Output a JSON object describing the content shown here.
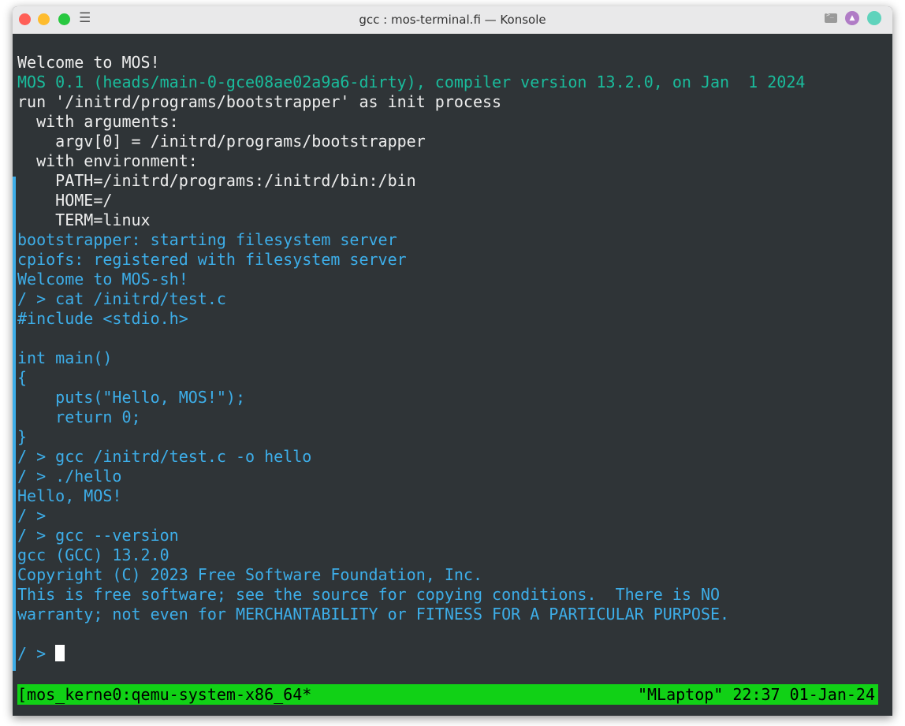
{
  "window": {
    "title": "gcc : mos-terminal.fi — Konsole",
    "menu_icon": "☰",
    "right_icons": [
      "terminal-icon",
      "arrow-up-icon",
      "keep-above-icon"
    ]
  },
  "terminal": {
    "lines": [
      {
        "text": "Welcome to MOS!",
        "color": "white"
      },
      {
        "text": "MOS 0.1 (heads/main-0-gce08ae02a9a6-dirty), compiler version 13.2.0, on Jan  1 2024",
        "color": "green"
      },
      {
        "text": "run '/initrd/programs/bootstrapper' as init process",
        "color": "white"
      },
      {
        "text": "  with arguments:",
        "color": "white"
      },
      {
        "text": "    argv[0] = /initrd/programs/bootstrapper",
        "color": "white"
      },
      {
        "text": "  with environment:",
        "color": "white"
      },
      {
        "text": "    PATH=/initrd/programs:/initrd/bin:/bin",
        "color": "white"
      },
      {
        "text": "    HOME=/",
        "color": "white"
      },
      {
        "text": "    TERM=linux",
        "color": "white"
      },
      {
        "text": "bootstrapper: starting filesystem server",
        "color": "blue"
      },
      {
        "text": "cpiofs: registered with filesystem server",
        "color": "blue"
      },
      {
        "text": "Welcome to MOS-sh!",
        "color": "blue"
      },
      {
        "text": "/ > cat /initrd/test.c",
        "color": "blue"
      },
      {
        "text": "#include <stdio.h>",
        "color": "blue"
      },
      {
        "text": "",
        "color": "blue"
      },
      {
        "text": "int main()",
        "color": "blue"
      },
      {
        "text": "{",
        "color": "blue"
      },
      {
        "text": "    puts(\"Hello, MOS!\");",
        "color": "blue"
      },
      {
        "text": "    return 0;",
        "color": "blue"
      },
      {
        "text": "}",
        "color": "blue"
      },
      {
        "text": "/ > gcc /initrd/test.c -o hello",
        "color": "blue"
      },
      {
        "text": "/ > ./hello",
        "color": "blue"
      },
      {
        "text": "Hello, MOS!",
        "color": "blue"
      },
      {
        "text": "/ >",
        "color": "blue"
      },
      {
        "text": "/ > gcc --version",
        "color": "blue"
      },
      {
        "text": "gcc (GCC) 13.2.0",
        "color": "blue"
      },
      {
        "text": "Copyright (C) 2023 Free Software Foundation, Inc.",
        "color": "blue"
      },
      {
        "text": "This is free software; see the source for copying conditions.  There is NO",
        "color": "blue"
      },
      {
        "text": "warranty; not even for MERCHANTABILITY or FITNESS FOR A PARTICULAR PURPOSE.",
        "color": "blue"
      },
      {
        "text": "",
        "color": "blue"
      }
    ],
    "prompt": "/ > ",
    "colors": {
      "background": "#2f3437",
      "white": "#eeeeee",
      "green": "#1abc9c",
      "blue": "#3daee9"
    }
  },
  "statusbar": {
    "left": "[mos_kerne0:qemu-system-x86_64*",
    "right": "\"MLaptop\" 22:37 01-Jan-24",
    "color": "#11d116"
  }
}
